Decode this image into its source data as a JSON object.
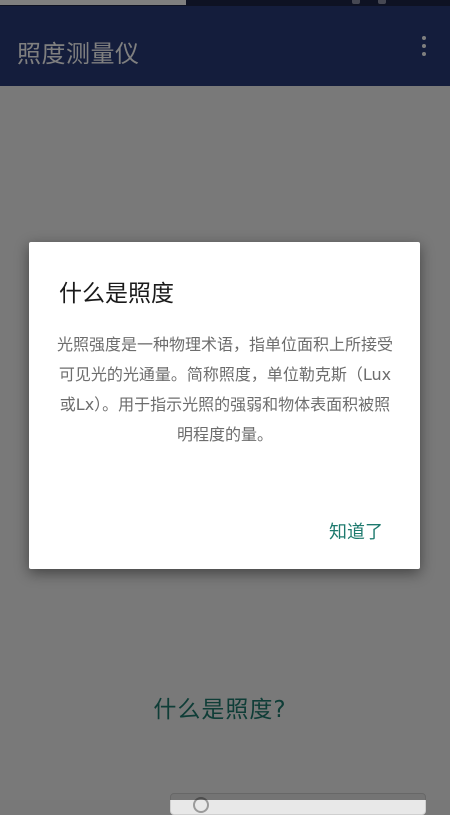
{
  "app_bar": {
    "title": "照度测量仪",
    "menu_icon": "more-vert-icon"
  },
  "main": {
    "link_text": "什么是照度?"
  },
  "dialog": {
    "title": "什么是照度",
    "message": "光照强度是一种物理术语，指单位面积上所接受可见光的光通量。简称照度，单位勒克斯（Lux或Lx）。用于指示光照的强弱和物体表面积被照明程度的量。",
    "action_label": "知道了"
  },
  "colors": {
    "app_bar": "#283a79",
    "accent": "#1e7a6e",
    "scrim": "rgba(0,0,0,0.5)"
  }
}
